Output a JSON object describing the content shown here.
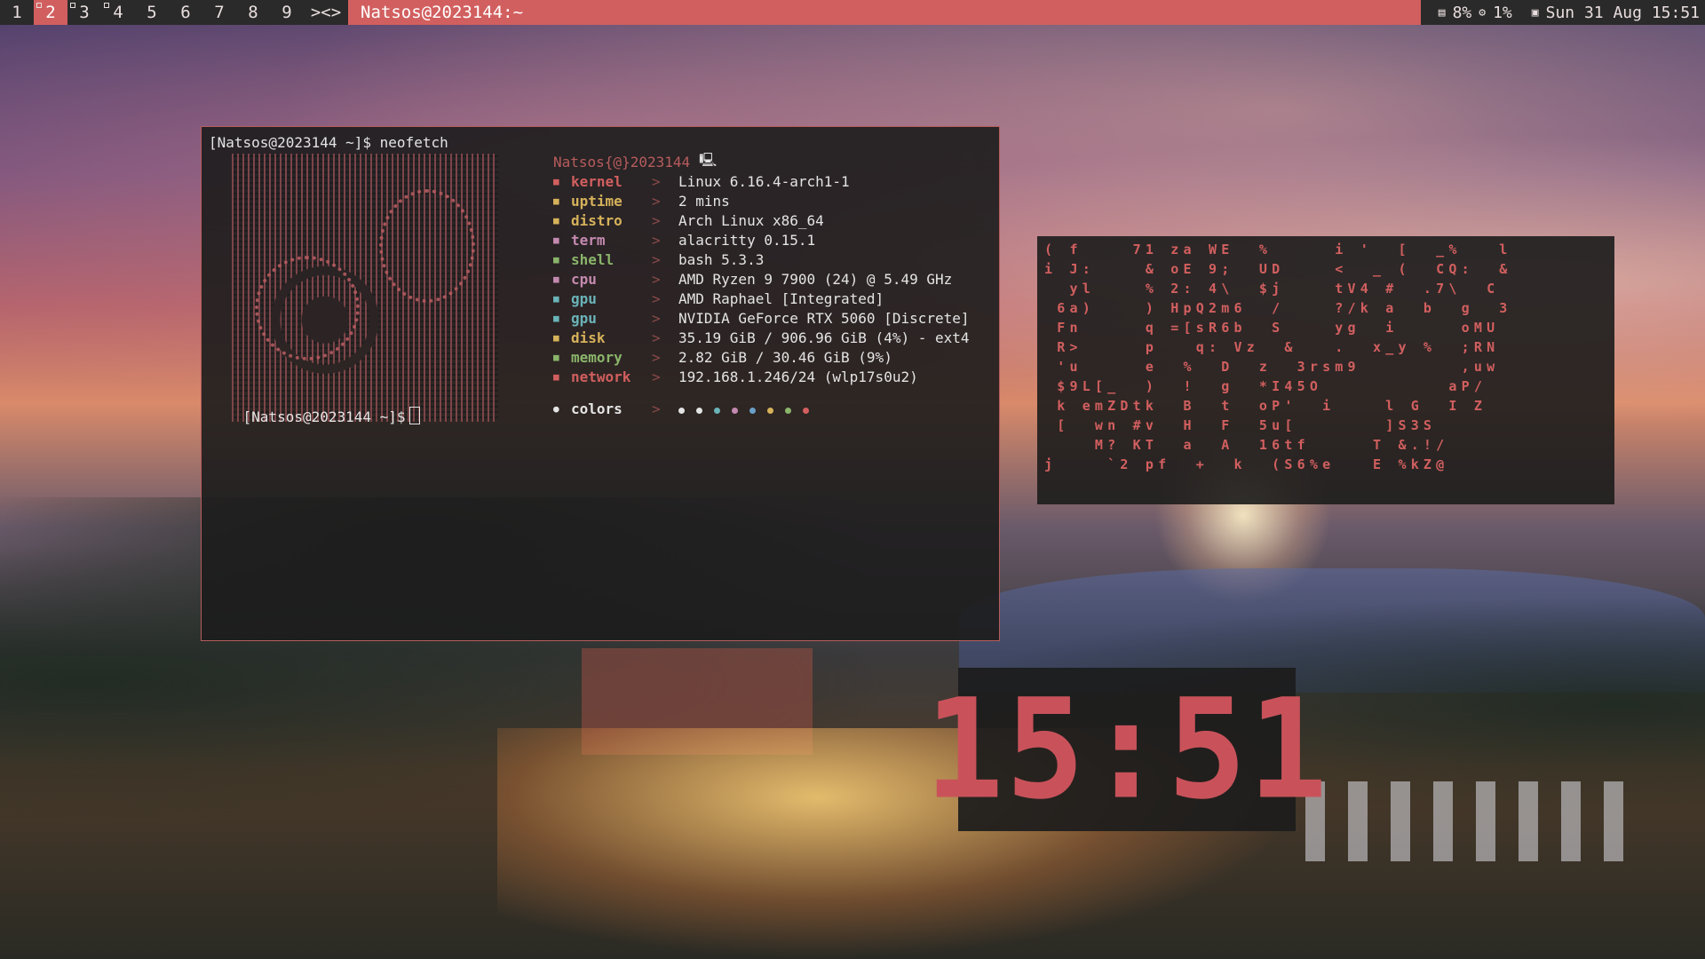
{
  "topbar": {
    "workspaces": [
      "1",
      "2",
      "3",
      "4",
      "5",
      "6",
      "7",
      "8",
      "9"
    ],
    "layout": "><>",
    "window_title": "Natsos@2023144:~",
    "status": {
      "mem_icon": "memory-icon",
      "mem": "8%",
      "cpu_icon": "cpu-icon",
      "cpu": "1%",
      "cal_icon": "calendar-icon",
      "datetime": "Sun 31 Aug 15:51"
    }
  },
  "terminal": {
    "prompt1": "[Natsos@2023144 ~]$ neofetch",
    "header": "Natsos{@}2023144",
    "rows": [
      {
        "icon": "gear-icon",
        "key": "kernel",
        "value": "Linux 6.16.4-arch1-1",
        "color": "#d25f5f"
      },
      {
        "icon": "clock-icon",
        "key": "uptime",
        "value": "2 mins",
        "color": "#d6b25a"
      },
      {
        "icon": "arch-icon",
        "key": "distro",
        "value": "Arch Linux x86_64",
        "color": "#d6b25a"
      },
      {
        "icon": "terminal-icon",
        "key": "term",
        "value": "alacritty 0.15.1",
        "color": "#c48ab0"
      },
      {
        "icon": "shell-icon",
        "key": "shell",
        "value": "bash 5.3.3",
        "color": "#8ab56a"
      },
      {
        "icon": "cpu-icon",
        "key": "cpu",
        "value": "AMD Ryzen 9 7900 (24) @ 5.49 GHz",
        "color": "#c48ab0"
      },
      {
        "icon": "gpu-icon",
        "key": "gpu",
        "value": "AMD Raphael [Integrated]",
        "color": "#6ab3b8"
      },
      {
        "icon": "gpu-icon",
        "key": "gpu",
        "value": "NVIDIA GeForce RTX 5060 [Discrete]",
        "color": "#6ab3b8"
      },
      {
        "icon": "disk-icon",
        "key": "disk",
        "value": "35.19 GiB / 906.96 GiB (4%) - ext4",
        "color": "#d6b25a"
      },
      {
        "icon": "memory-icon",
        "key": "memory",
        "value": "2.82 GiB / 30.46 GiB (9%)",
        "color": "#8ab56a"
      },
      {
        "icon": "network-icon",
        "key": "network",
        "value": "192.168.1.246/24 (wlp17s0u2)",
        "color": "#d25f5f"
      }
    ],
    "colors_label": "colors",
    "arrow": ">",
    "palette": [
      "#e4e4e4",
      "#e4e4e4",
      "#6ab3b8",
      "#c48ab0",
      "#6aa0c8",
      "#d6b25a",
      "#8ab56a",
      "#d25f5f"
    ],
    "prompt2": "[Natsos@2023144 ~]$"
  },
  "matrix_rows": [
    "( f    71 za WE  %     i '  [  _%   l",
    "i J:    & oE 9;  UD    <  _ (  CQ:  &",
    "  yl    % 2: 4\\  $j    tV4 #  .7\\  C",
    " 6a)    ) HpQ2m6  /    ?/k a  b  g  3",
    " Fn     q =[sR6b  S    yg  i     oMU",
    " R>     p   q: Vz  &   .  x_y %  ;RN",
    " 'u     e  %  D  z  3rsm9        ,uw",
    " $9L[_  )  !  g  *I45O          aP/",
    " k emZDtk  B  t  oP'  i    l G  I Z",
    " [  wn #v  H  F  5u[       ]S3S",
    "    M? KT  a  A  16tf     T &.!/",
    "j    `2 pf  +  k  (S6%e   E %kZ@"
  ],
  "clock": {
    "time": "15:51"
  }
}
